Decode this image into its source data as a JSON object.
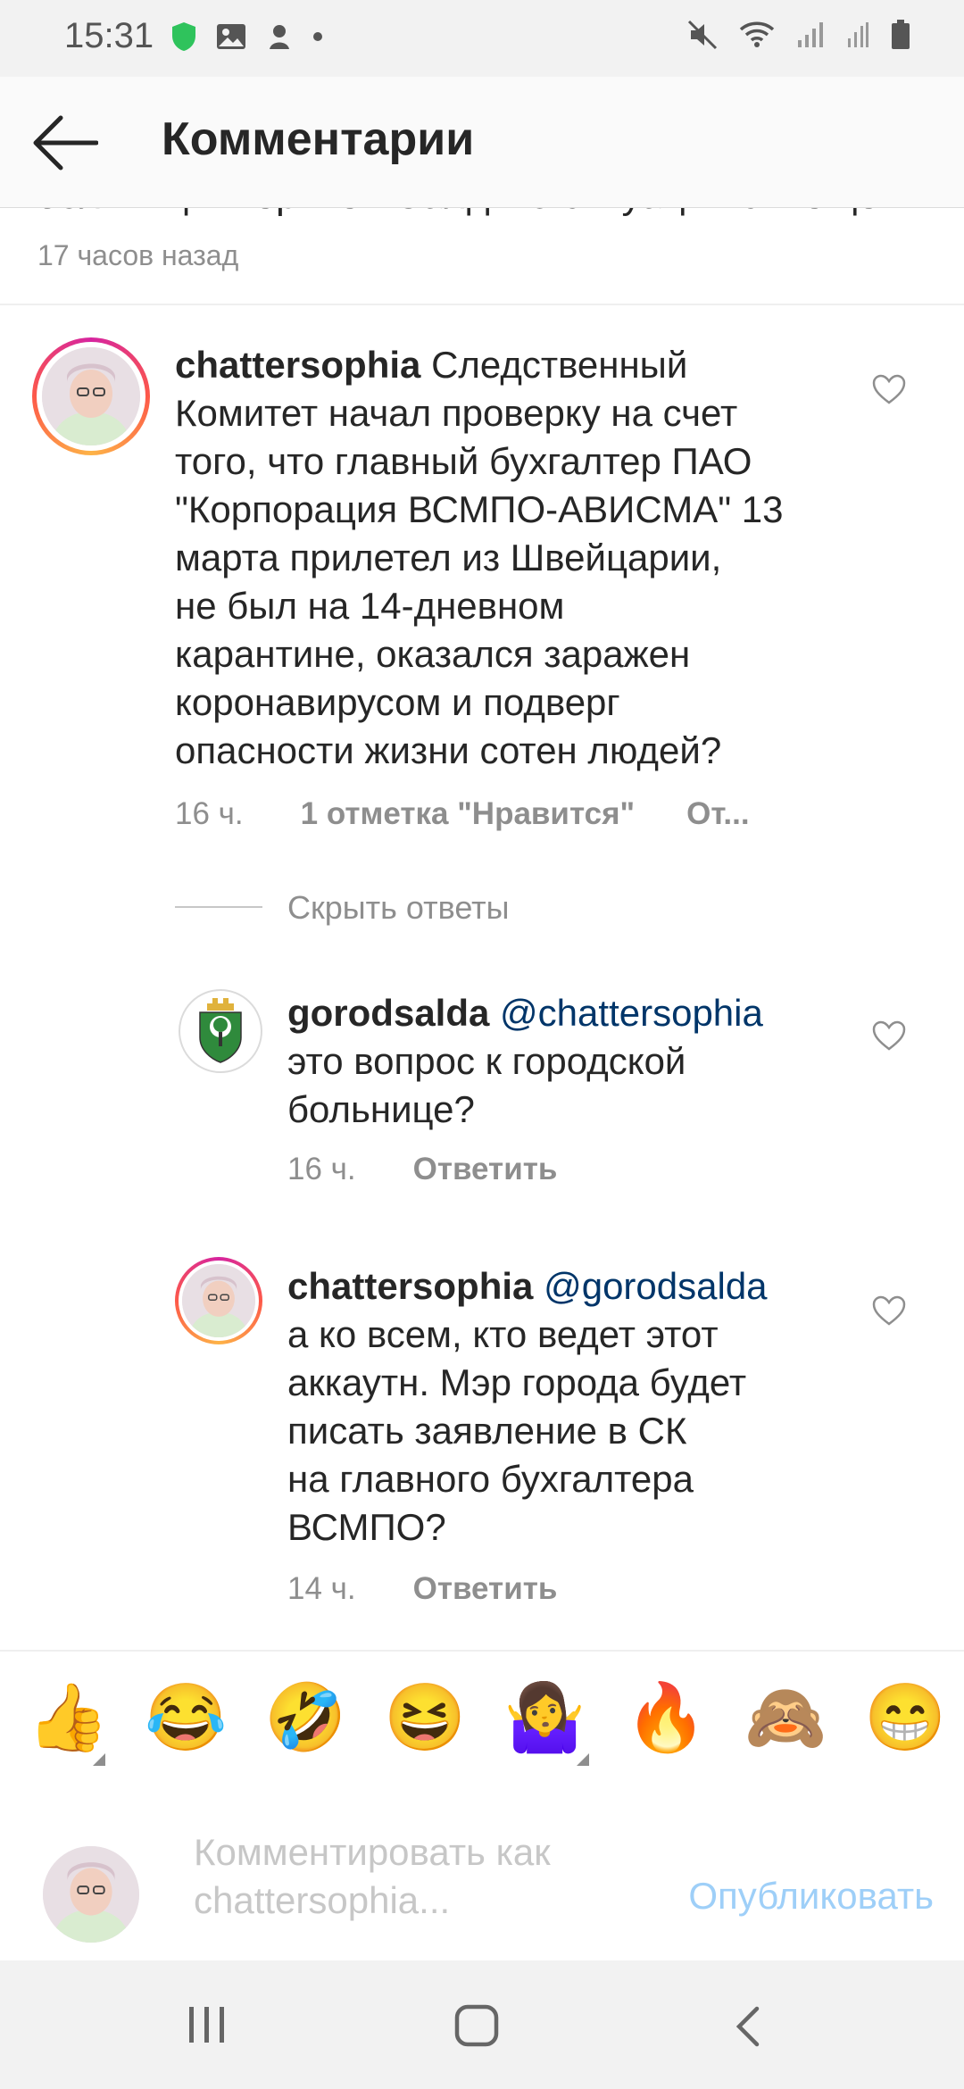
{
  "status_bar": {
    "time": "15:31"
  },
  "header": {
    "title": "Комментарии"
  },
  "previous_comment": {
    "partial_text": "больницы Верхней Салды о ситуации с... ещё",
    "time": "17 часов назад"
  },
  "comments": [
    {
      "username": "chattersophia",
      "lines": [
        "Следственный",
        "Комитет начал проверку на счет",
        "того, что главный бухгалтер ПАО",
        "\"Корпорация ВСМПО-АВИСМА\" 13",
        "марта прилетел из Швейцарии,",
        "не был на 14-дневном",
        "карантине, оказался заражен",
        "коронавирусом и подверг",
        "опасности жизни сотен людей?"
      ],
      "time": "16 ч.",
      "likes": "1 отметка \"Нравится\"",
      "reply": "От..."
    }
  ],
  "hide_replies": "Скрыть ответы",
  "replies": [
    {
      "username": "gorodsalda",
      "mention": "@chattersophia",
      "lines": [
        "это вопрос к городской",
        "больнице?"
      ],
      "time": "16 ч.",
      "reply": "Ответить"
    },
    {
      "username": "chattersophia",
      "mention": "@gorodsalda",
      "lines": [
        "а ко всем, кто ведет этот",
        "аккаутн. Мэр города будет",
        "писать заявление в СК",
        "на главного бухгалтера",
        "ВСМПО?"
      ],
      "time": "14 ч.",
      "reply": "Ответить"
    }
  ],
  "emoji_bar": [
    "👍",
    "😂",
    "🤣",
    "😆",
    "🤷‍♀️",
    "🔥",
    "🙈",
    "😁"
  ],
  "comment_input": {
    "placeholder_line1": "Комментировать как",
    "placeholder_line2": "chattersophia...",
    "publish_label": "Опубликовать"
  },
  "colors": {
    "mention": "#003569",
    "publish_disabled": "#9ecff8",
    "meta": "#8e8e8e"
  }
}
